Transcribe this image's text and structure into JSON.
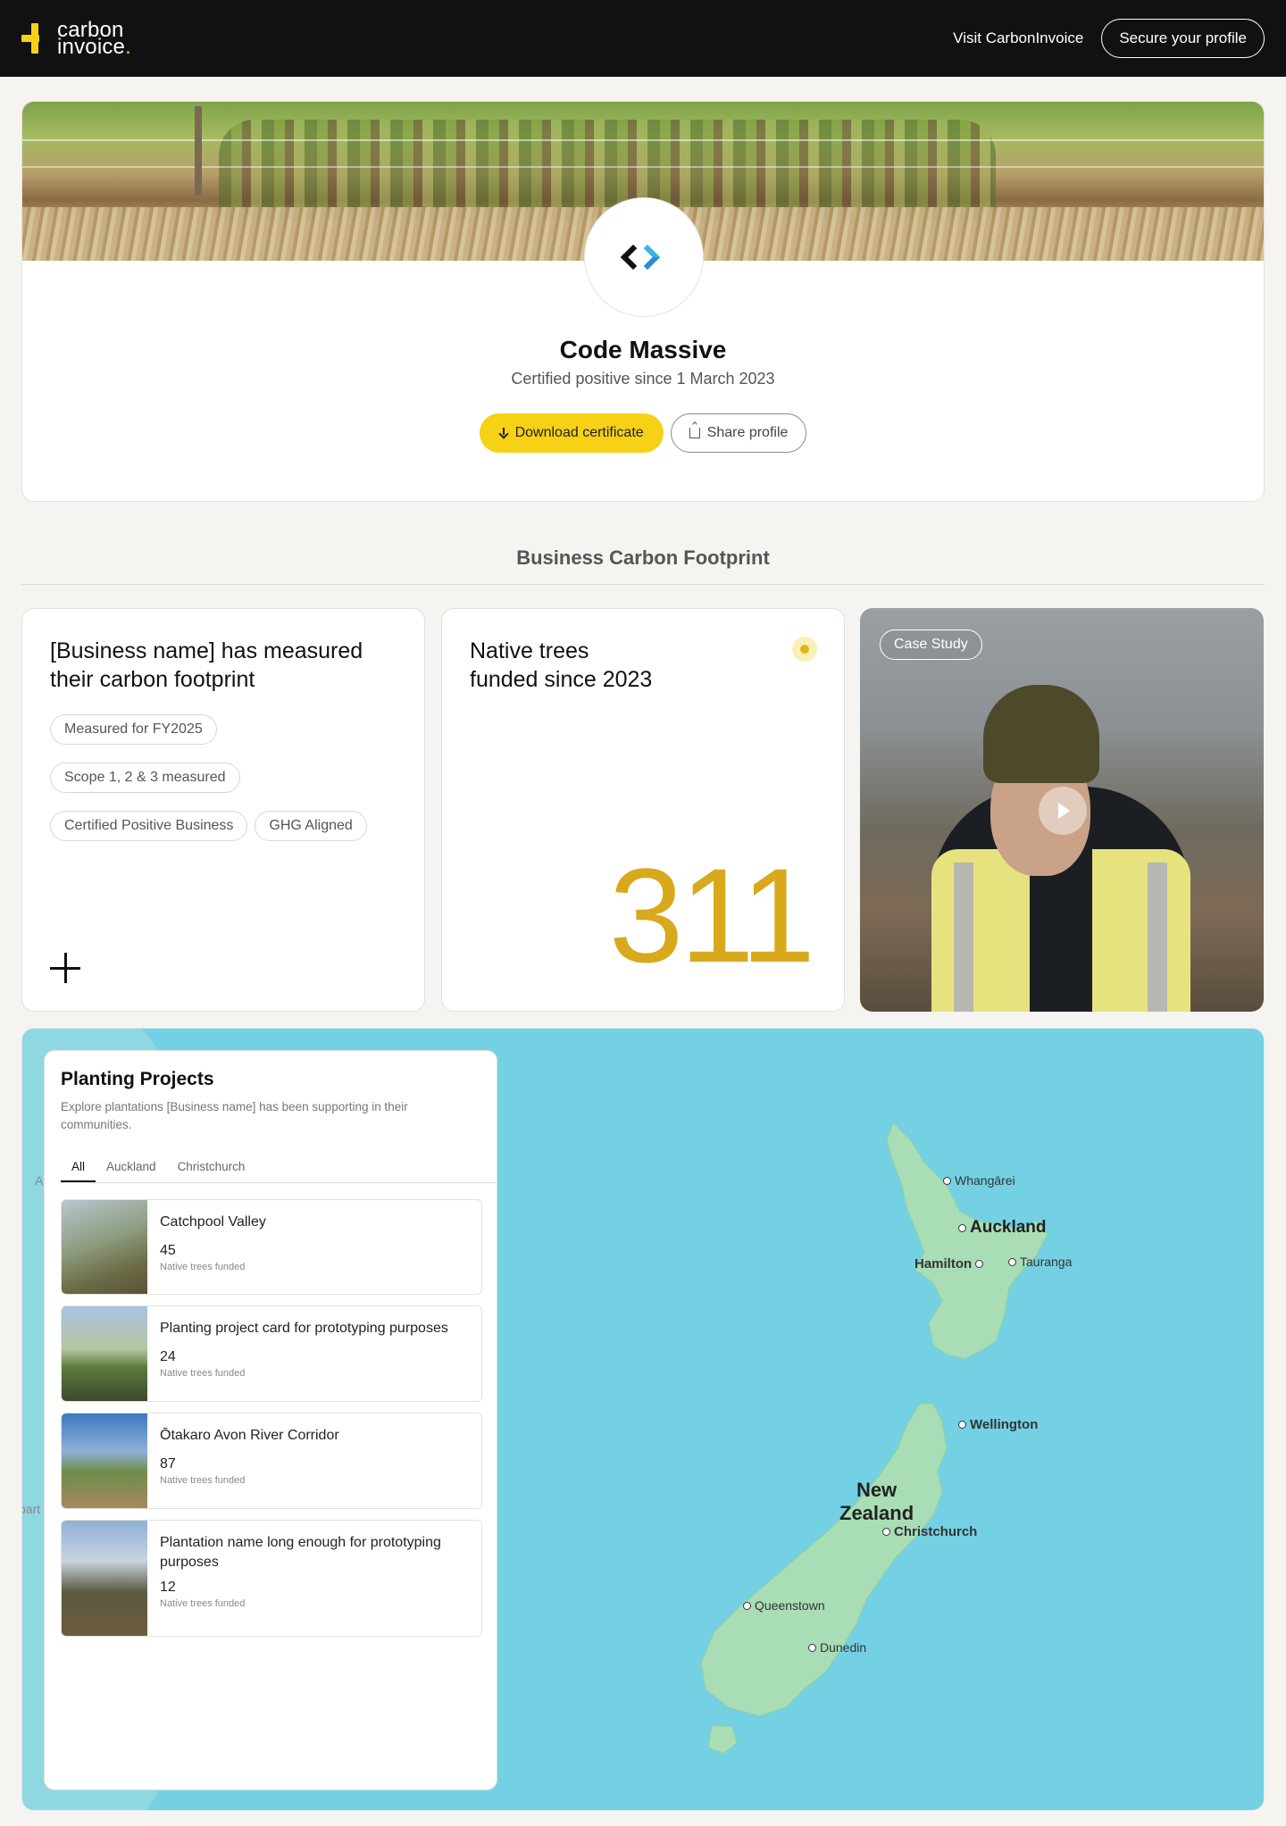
{
  "header": {
    "logo_line1": "carbon",
    "logo_line2": "invoice",
    "logo_dot": ".",
    "visit_link": "Visit CarbonInvoice",
    "secure_button": "Secure your profile"
  },
  "profile": {
    "company_name": "Code Massive",
    "subtitle": "Certified positive since 1 March 2023",
    "download_button": "Download certificate",
    "share_button": "Share profile"
  },
  "footprint": {
    "section_title": "Business Carbon Footprint",
    "measured_card": {
      "heading": "[Business name] has measured their carbon footprint",
      "chips": [
        "Measured for FY2025",
        "Scope 1, 2 & 3 measured",
        "Certified Positive Business",
        "GHG Aligned"
      ]
    },
    "trees_card": {
      "heading_line1": "Native trees",
      "heading_line2": "funded since 2023",
      "count": "311"
    },
    "case_study": {
      "tag": "Case Study"
    }
  },
  "planting": {
    "title": "Planting Projects",
    "description": "Explore plantations [Business name] has been supporting in their communities.",
    "tabs": [
      "All",
      "Auckland",
      "Christchurch"
    ],
    "active_tab": "All",
    "projects": [
      {
        "name": "Catchpool Valley",
        "count": "45",
        "label": "Native trees funded"
      },
      {
        "name": "Planting project card for prototyping purposes",
        "count": "24",
        "label": "Native trees funded"
      },
      {
        "name": "Ōtakaro Avon River Corridor",
        "count": "87",
        "label": "Native trees funded"
      },
      {
        "name": "Plantation name long enough for prototyping purposes",
        "count": "12",
        "label": "Native trees funded"
      }
    ]
  },
  "map": {
    "country_line1": "New",
    "country_line2": "Zealand",
    "cities": {
      "whangarei": "Whangārei",
      "auckland": "Auckland",
      "hamilton": "Hamilton",
      "tauranga": "Tauranga",
      "wellington": "Wellington",
      "christchurch": "Christchurch",
      "queenstown": "Queenstown",
      "dunedin": "Dunedin"
    },
    "edge_label_a": "A",
    "edge_label_b": "part"
  },
  "colors": {
    "brand_yellow": "#f7d115",
    "number_gold": "#d9a91c",
    "header_bg": "#111111",
    "ocean": "#74d1e4",
    "land": "#a8ddb5"
  }
}
